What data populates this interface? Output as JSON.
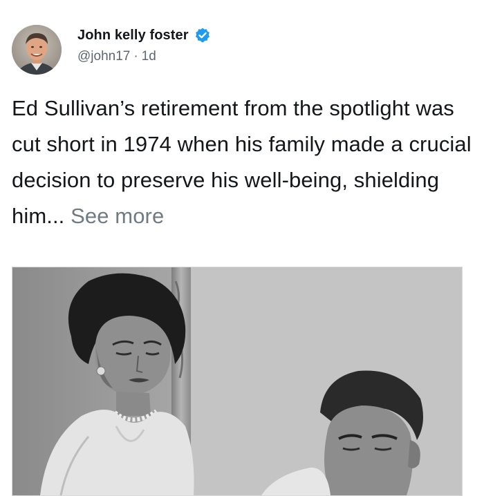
{
  "post": {
    "author_name": "John kelly foster",
    "handle": "@john17",
    "separator": "·",
    "time_ago": "1d",
    "text": "Ed Sullivan’s retirement from the spotlight was cut short in 1974 when his family made a crucial decision to preserve his well-being, shielding him... ",
    "see_more_label": "See more",
    "verified_badge_icon": "verified-badge-icon",
    "accent_color": "#1d9bf0"
  }
}
